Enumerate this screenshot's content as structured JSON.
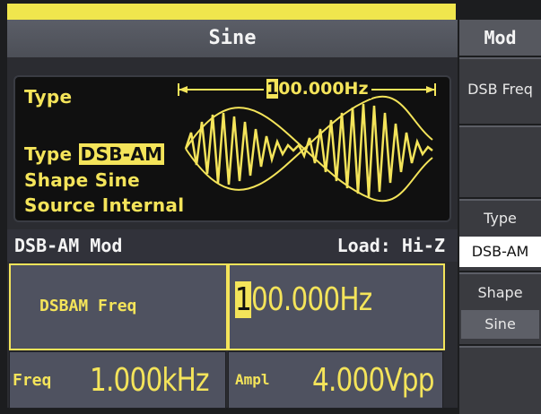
{
  "title": "Sine",
  "wave_panel": {
    "type_label": "Type",
    "freq_marker": "100.000Hz",
    "freq_cursor_digit": "1",
    "freq_rest": "00.000Hz",
    "type_prefix": "Type",
    "type_value": "DSB-AM",
    "shape_line": "Shape Sine",
    "source_line": "Source Internal"
  },
  "status": {
    "mode": "DSB-AM Mod",
    "load": "Load: Hi-Z"
  },
  "params": {
    "dsbam_freq_label": "DSBAM Freq",
    "dsbam_freq_cursor": "1",
    "dsbam_freq_rest": "00.000Hz",
    "freq_label": "Freq",
    "freq_value": "1.000kHz",
    "ampl_label": "Ampl",
    "ampl_value": "4.000Vpp"
  },
  "softkeys": {
    "header": "Mod",
    "key1": "DSB Freq",
    "key2": "",
    "type_label": "Type",
    "type_value": "DSB-AM",
    "shape_label": "Shape",
    "shape_value": "Sine",
    "key5": ""
  },
  "colors": {
    "accent": "#f4e45a",
    "background": "#2b2c31",
    "panel": "#4f5260"
  }
}
